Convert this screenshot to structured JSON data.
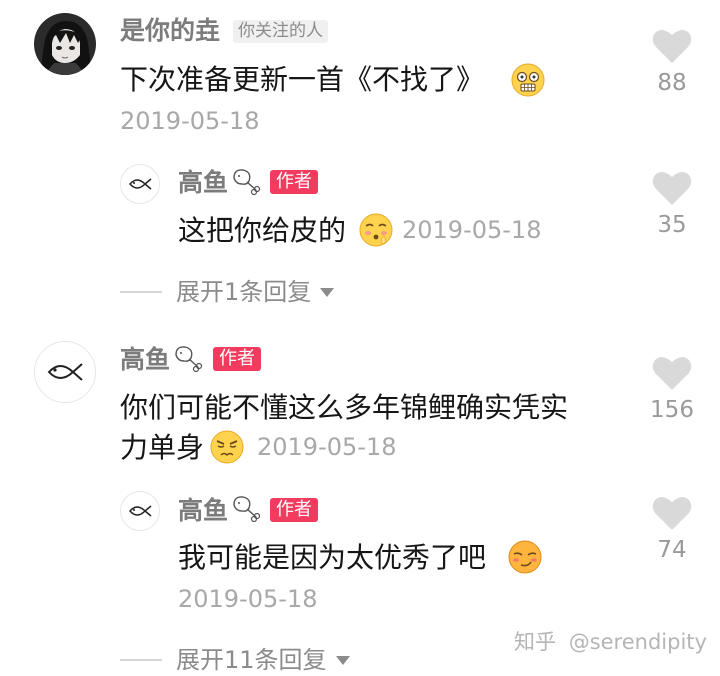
{
  "comments": [
    {
      "username": "是你的垚",
      "follow_badge": "你关注的人",
      "text": "下次准备更新一首《不找了》",
      "date": "2019-05-18",
      "likes": "88",
      "replies": [
        {
          "username": "高鱼",
          "author_badge": "作者",
          "text": "这把你给皮的",
          "date": "2019-05-18",
          "likes": "35"
        }
      ],
      "expand_label": "展开1条回复"
    },
    {
      "username": "高鱼",
      "author_badge": "作者",
      "text_line1": "你们可能不懂这么多年锦鲤确实凭实",
      "text_line2": "力单身",
      "date": "2019-05-18",
      "likes": "156",
      "replies": [
        {
          "username": "高鱼",
          "author_badge": "作者",
          "text": "我可能是因为太优秀了吧",
          "date": "2019-05-18",
          "likes": "74"
        }
      ],
      "expand_label": "展开11条回复"
    }
  ],
  "watermark": {
    "site": "知乎",
    "handle": "@serendipity"
  },
  "colors": {
    "author_badge": "#f23b5e",
    "text": "#161616",
    "username": "#7c7c7c",
    "date": "#a8a8a8",
    "like_heart": "#d9d9d9"
  },
  "icons": [
    "anime-avatar",
    "fish-avatar",
    "chicken-leg-icon",
    "heart-icon",
    "chevron-down-icon",
    "emoji"
  ]
}
